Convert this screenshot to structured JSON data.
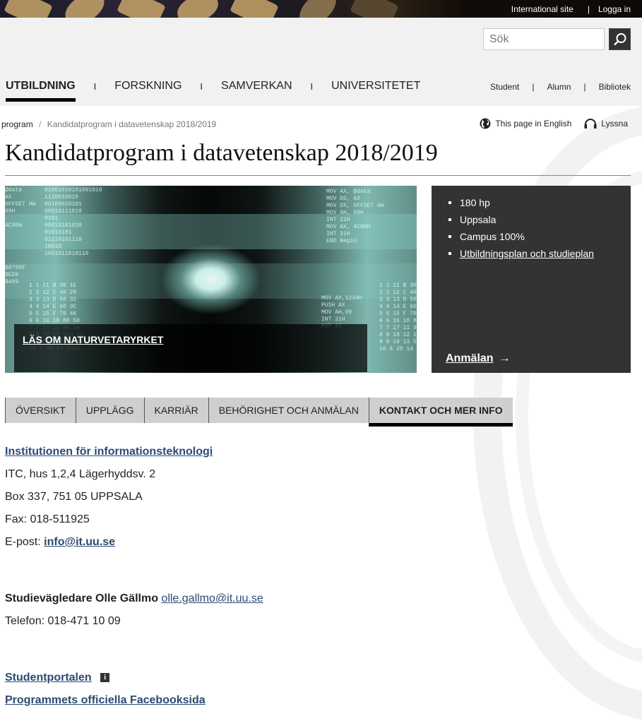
{
  "topbar": {
    "international_site": "International site",
    "separator": "|",
    "login": "Logga in"
  },
  "search": {
    "placeholder": "Sök",
    "icon": "search-icon"
  },
  "main_nav": {
    "items": [
      {
        "label": "UTBILDNING",
        "active": true
      },
      {
        "label": "FORSKNING",
        "active": false
      },
      {
        "label": "SAMVERKAN",
        "active": false
      },
      {
        "label": "UNIVERSITETET",
        "active": false
      }
    ],
    "separator": "I"
  },
  "sub_nav": {
    "items": [
      "Student",
      "Alumn",
      "Bibliotek"
    ],
    "separator": "|"
  },
  "breadcrumb": {
    "items": [
      "program",
      "Kandidatprogram i datavetenskap 2018/2019"
    ],
    "separator": "/"
  },
  "tools": {
    "english": {
      "label": "This page in English",
      "icon": "globe-icon"
    },
    "listen": {
      "label": "Lyssna",
      "icon": "headphones-icon"
    }
  },
  "page": {
    "title": "Kandidatprogram i datavetenskap 2018/2019"
  },
  "hero": {
    "caption_link": "LÄS OM NATURVETARYRKET",
    "code_left": "01001010101001010\n1110010010\n00100010101\n00010111010\n0101\n00010101010\n01010101\n01110101110\n10010\n1001011010110",
    "code_left_edge": "@data\nAX\nOFFSET HW\n09H\n\nAC00H\n\n\n\n\n\nB8790F\n8ED8\nB409",
    "code_right": "MOV AX, @data\nMOV DS, AX\nMOV DX, OFFSET HW\nMOV AH, 09H\nINT 21H\nMOV AX, 4C00H\nINT 21H\nEND Begin",
    "code_right2": "MOV AX,1234H\nPUSH AX\nMOV AH,09\nINT 21H\nPOP AX",
    "code_grid": "1 1 11 B 30 1E\n2 2 12 C 40 28\n3 3 13 D 50 32\n4 4 14 E 60 3C\n5 5 15 F 70 46\n6 6 16 10 80 50\n7 7 17 11 90 5A\n8 8 18 12 100 64\n9 9 19 13 500 1F4\n10 A 20 14 1000"
  },
  "facts": {
    "items": [
      {
        "label": "180 hp",
        "link": false
      },
      {
        "label": "Uppsala",
        "link": false
      },
      {
        "label": "Campus 100%",
        "link": false
      },
      {
        "label": "Utbildningsplan och studieplan",
        "link": true
      }
    ],
    "apply_label": "Anmälan",
    "apply_arrow": "→"
  },
  "tabs": [
    {
      "label": "ÖVERSIKT",
      "active": false
    },
    {
      "label": "UPPLÄGG",
      "active": false
    },
    {
      "label": "KARRIÄR",
      "active": false
    },
    {
      "label": "BEHÖRIGHET OCH ANMÄLAN",
      "active": false
    },
    {
      "label": "KONTAKT OCH MER INFO",
      "active": true
    }
  ],
  "contact": {
    "department_link": "Institutionen för informationsteknologi",
    "address1": "ITC, hus 1,2,4 Lägerhyddsv. 2",
    "address2": "Box 337, 751 05 UPPSALA",
    "fax": "Fax: 018-511925",
    "email_label": "E-post:",
    "email": "info@it.uu.se",
    "advisor_label": "Studievägledare Olle Gällmo",
    "advisor_email": "olle.gallmo@it.uu.se",
    "phone": "Telefon: 018-471 10 09",
    "student_portal": "Studentportalen",
    "info_icon": "i",
    "facebook": "Programmets officiella Facebooksida"
  },
  "colors": {
    "link": "#2b4a73",
    "facts_bg": "#333333",
    "tab_bg": "#cfcfcf",
    "header_bg": "#f1f1f1"
  }
}
